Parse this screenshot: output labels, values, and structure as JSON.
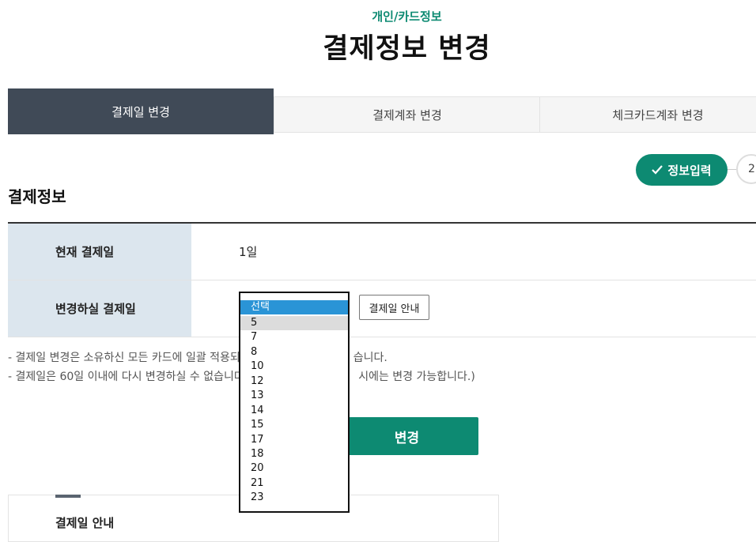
{
  "header": {
    "category": "개인/카드정보",
    "title": "결제정보 변경"
  },
  "tabs": [
    {
      "label": "결제일 변경",
      "active": true
    },
    {
      "label": "결제계좌 변경",
      "active": false
    },
    {
      "label": "체크카드계좌 변경",
      "active": false
    }
  ],
  "steps": {
    "current_label": "정보입력",
    "next_number": "2"
  },
  "section": {
    "title": "결제정보"
  },
  "table": {
    "current_label": "현재 결제일",
    "current_value": "1일",
    "new_label": "변경하실 결제일"
  },
  "guide_button_label": "결제일 안내",
  "dropdown": {
    "options": [
      "선택",
      "5",
      "7",
      "8",
      "10",
      "12",
      "13",
      "14",
      "15",
      "17",
      "18",
      "20",
      "21",
      "23"
    ],
    "selected": "선택",
    "highlighted": "5"
  },
  "notes": [
    {
      "before": "- 결제일 변경은 소유하신 모든 카드에 일괄 적용되며",
      "after": "습니다."
    },
    {
      "before": "- 결제일은 60일 이내에 다시 변경하실 수 없습니다.",
      "after": "시에는 변경 가능합니다.)"
    }
  ],
  "submit_label": "변경",
  "guide_section_title": "결제일 안내",
  "colors": {
    "accent": "#0d8a72",
    "tab_active": "#404a57",
    "table_header": "#dce6ee",
    "select_highlight": "#2a94d6"
  }
}
